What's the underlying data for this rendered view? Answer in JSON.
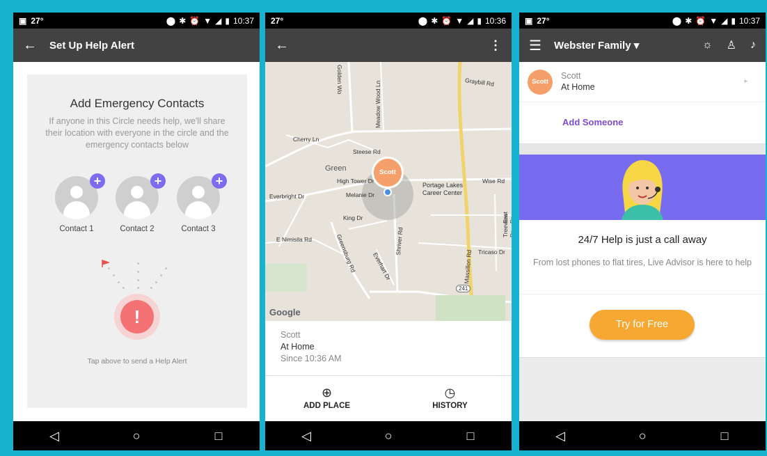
{
  "status_bar": {
    "temp": "27°",
    "time_p1": "10:37",
    "time_p2": "10:36",
    "time_p3": "10:37"
  },
  "phone1": {
    "title": "Set Up Help Alert",
    "heading": "Add Emergency Contacts",
    "description": "If anyone in this Circle needs help, we'll share their location with everyone in the circle and the emergency contacts below",
    "contacts": [
      "Contact 1",
      "Contact 2",
      "Contact 3"
    ],
    "alert_symbol": "!",
    "tap_hint": "Tap above to send a Help Alert"
  },
  "phone2": {
    "map_labels": {
      "golden": "Golden Wo",
      "meadow": "Meadow Wood Ln",
      "graybill": "Graybill Rd",
      "cherry": "Cherry Ln",
      "steese": "Steese Rd",
      "green": "Green",
      "hightower": "High Tower Dr",
      "melanie": "Melanie Dr",
      "portage1": "Portage Lakes",
      "portage2": "Career Center",
      "wise": "Wise Rd",
      "everbright": "Everbright Dr",
      "king": "King Dr",
      "shriver": "Shriver Rd",
      "treeview": "Treeview Dr",
      "eastdr": "East Dr",
      "nimisila": "E Nimisila Rd",
      "greensburg": "Greensburg Rd",
      "everhart": "Everhart Dr",
      "massillon": "Massillon Rd",
      "tricaso": "Tricaso Dr",
      "route": "241"
    },
    "pin_name": "Scott",
    "google": "Google",
    "location_name": "Scott",
    "location_place": "At Home",
    "location_since": "Since 10:36 AM",
    "add_place": "ADD PLACE",
    "history": "HISTORY"
  },
  "phone3": {
    "circle_name": "Webster Family",
    "member_avatar": "Scott",
    "member_name": "Scott",
    "member_status": "At Home",
    "add_someone": "Add Someone",
    "card_title": "24/7 Help is just a call away",
    "card_desc": "From lost phones to flat tires, Live Advisor is here to help",
    "cta": "Try for Free"
  },
  "colors": {
    "frame": "#16b3d1",
    "appbar": "#424242",
    "accent_purple": "#776bf0",
    "alert_red": "#f47174",
    "avatar_orange": "#f5a06a",
    "cta_orange": "#f7a833",
    "add_link": "#7c4ccf"
  },
  "icons": [
    "back-arrow-icon",
    "more-vert-icon",
    "menu-icon",
    "lightbulb-icon",
    "person-icon",
    "bell-icon",
    "location-pin-icon",
    "bluetooth-icon",
    "alarm-icon",
    "wifi-icon",
    "signal-icon",
    "battery-icon",
    "add-place-icon",
    "history-icon",
    "nav-back-icon",
    "nav-home-icon",
    "nav-recent-icon"
  ]
}
